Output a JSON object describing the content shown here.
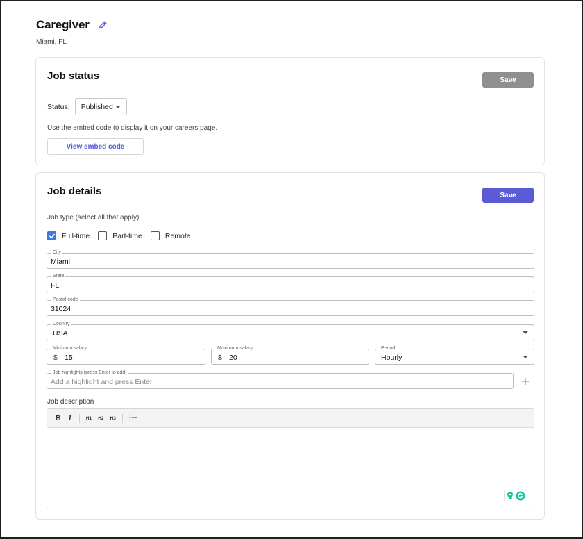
{
  "header": {
    "title": "Caregiver",
    "location": "Miami, FL"
  },
  "job_status": {
    "title": "Job status",
    "save_label": "Save",
    "status_label": "Status:",
    "status_value": "Published",
    "embed_help": "Use the embed code to display it on your careers page.",
    "embed_button": "View embed code"
  },
  "job_details": {
    "title": "Job details",
    "save_label": "Save",
    "job_type_label": "Job type (select all that apply)",
    "job_types": [
      {
        "label": "Full-time",
        "checked": true
      },
      {
        "label": "Part-time",
        "checked": false
      },
      {
        "label": "Remote",
        "checked": false
      }
    ],
    "city": {
      "label": "City",
      "value": "Miami"
    },
    "state": {
      "label": "State",
      "value": "FL"
    },
    "postal": {
      "label": "Postal code",
      "value": "31024"
    },
    "country": {
      "label": "Country",
      "value": "USA"
    },
    "min_salary": {
      "label": "Minimum salary",
      "currency": "$",
      "value": "15"
    },
    "max_salary": {
      "label": "Maximum salary",
      "currency": "$",
      "value": "20"
    },
    "period": {
      "label": "Period",
      "value": "Hourly"
    },
    "highlights": {
      "label": "Job highlights (press Enter to add)",
      "placeholder": "Add a highlight and press Enter"
    },
    "description_label": "Job description",
    "toolbar": {
      "bold": "B",
      "italic": "I",
      "h1": "H1",
      "h2": "H2",
      "h3": "H3"
    }
  },
  "colors": {
    "accent": "#5b5bd6",
    "save_disabled": "#8f8f8f",
    "checkbox": "#3b7be0",
    "grammarly": "#15c39a"
  },
  "icons": [
    "pencil-icon",
    "chevron-down-icon",
    "check-icon",
    "plus-icon",
    "bullet-list-icon",
    "grammarly-icon"
  ]
}
